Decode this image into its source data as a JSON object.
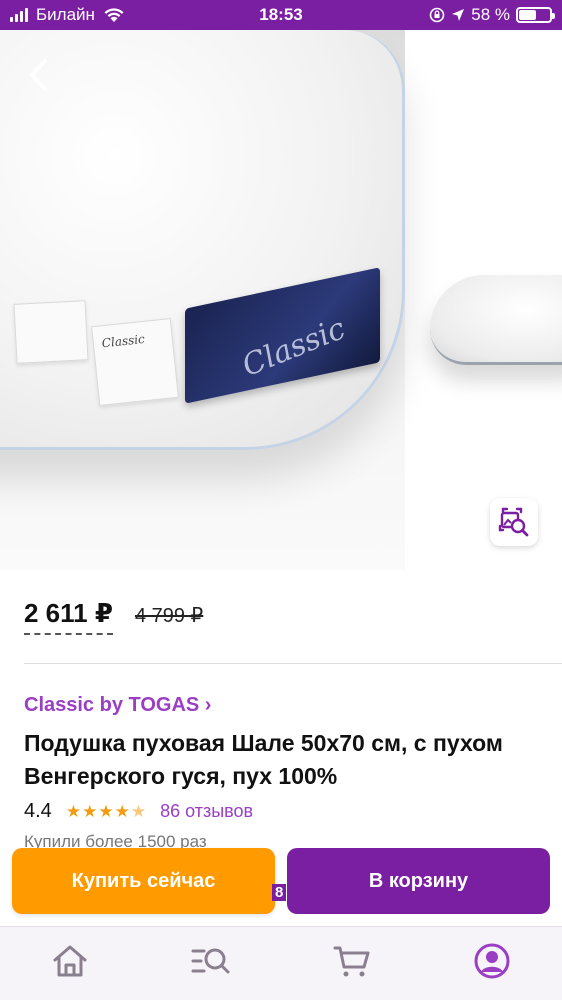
{
  "status_bar": {
    "carrier": "Билайн",
    "time": "18:53",
    "battery_percent": "58 %",
    "battery_level": 0.58,
    "icons": [
      "signal-icon",
      "wifi-icon",
      "rotation-lock-icon",
      "location-icon",
      "battery-icon"
    ]
  },
  "header": {
    "icons": [
      "back-chevron-icon",
      "heart-icon",
      "share-icon",
      "visual-search-icon"
    ]
  },
  "product": {
    "image_labels": {
      "ribbon": "Classic",
      "tag": "Classic"
    },
    "price_current": "2 611 ₽",
    "price_old": "4 799 ₽",
    "brand": "Classic by TOGAS ›",
    "title": "Подушка пуховая Шале 50x70 см, с пухом Венгерского гуся, пух 100%",
    "rating": "4.4",
    "rating_value": 4.4,
    "reviews": "86 отзывов",
    "purchased": "Купили более 1500 раз"
  },
  "actions": {
    "buy_now": "Купить сейчас",
    "add_to_cart": "В корзину",
    "badge_fragment": "8"
  },
  "colors": {
    "brand_purple": "#7b1fa2",
    "link_purple": "#9a3ec4",
    "orange": "#ff9a00",
    "star": "#f39c12"
  },
  "tab_bar": {
    "icons": [
      "home-icon",
      "catalog-search-icon",
      "cart-icon",
      "profile-icon"
    ]
  }
}
